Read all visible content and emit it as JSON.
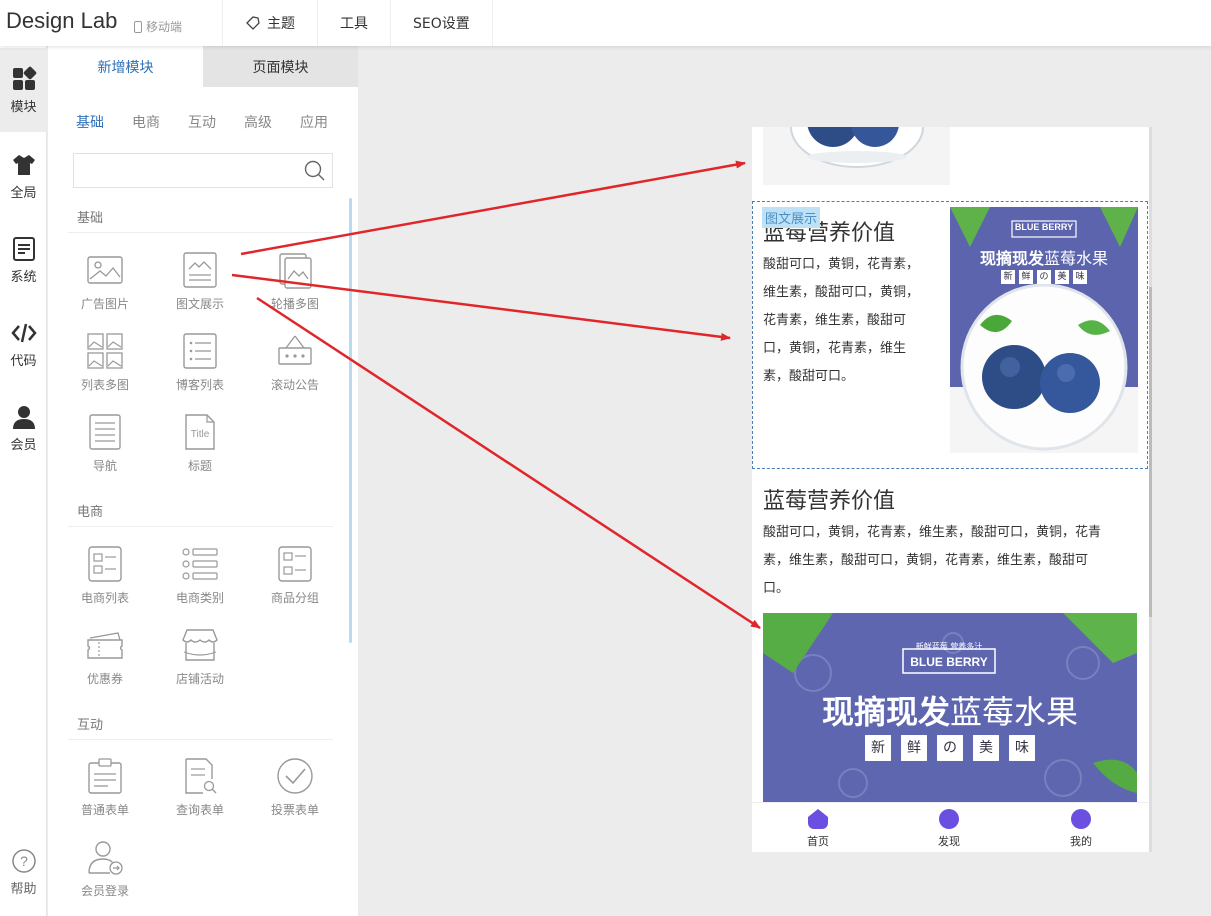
{
  "app": {
    "brand": "Design Lab",
    "mode": "移动端"
  },
  "topnav": [
    {
      "label": "主题",
      "icon": "theme-icon"
    },
    {
      "label": "工具"
    },
    {
      "label": "SEO设置"
    }
  ],
  "rail": [
    {
      "label": "模块",
      "icon": "modules-icon"
    },
    {
      "label": "全局",
      "icon": "shirt-icon"
    },
    {
      "label": "系统",
      "icon": "document-icon"
    },
    {
      "label": "代码",
      "icon": "code-icon"
    },
    {
      "label": "会员",
      "icon": "user-icon"
    },
    {
      "label": "帮助",
      "icon": "help-icon"
    }
  ],
  "panel": {
    "tabs": [
      "新增模块",
      "页面模块"
    ],
    "categories": [
      "基础",
      "电商",
      "互动",
      "高级",
      "应用"
    ],
    "search": {
      "placeholder": "",
      "value": ""
    },
    "sections": [
      {
        "title": "基础",
        "modules": [
          "广告图片",
          "图文展示",
          "轮播多图",
          "列表多图",
          "博客列表",
          "滚动公告",
          "导航",
          "标题"
        ]
      },
      {
        "title": "电商",
        "modules": [
          "电商列表",
          "电商类别",
          "商品分组",
          "优惠券",
          "店铺活动"
        ]
      },
      {
        "title": "互动",
        "modules": [
          "普通表单",
          "查询表单",
          "投票表单",
          "会员登录"
        ]
      }
    ]
  },
  "preview": {
    "selected_tag": "图文展示",
    "card1": {
      "heading": "蓝莓营养价值",
      "lines": [
        "酸甜可口，黄铜，花青素，",
        "维生素，酸甜可口，黄铜，",
        "花青素，维生素，酸甜可",
        "口，黄铜，花青素，维生",
        "素，酸甜可口。"
      ]
    },
    "card2": {
      "heading": "蓝莓营养价值",
      "lines": [
        "酸甜可口，黄铜，花青素，维生素，酸甜可口，黄铜，花青",
        "素，维生素，酸甜可口，黄铜，花青素，维生素，酸甜可",
        "口。"
      ]
    },
    "product_image": {
      "tag": "BLUE BERRY",
      "title_bold": "现摘现发",
      "title_rest": "蓝莓水果",
      "chars": [
        "新",
        "鲜",
        "の",
        "美",
        "味"
      ]
    },
    "banner": {
      "small": "新鲜蓝莓 营养多汁",
      "tag": "BLUE BERRY",
      "title_bold": "现摘现发",
      "title_rest": "蓝莓水果",
      "chars": [
        "新",
        "鲜",
        "の",
        "美",
        "味"
      ]
    },
    "tabbar": [
      "首页",
      "发现",
      "我的"
    ]
  },
  "colors": {
    "accent": "#2f6fb6",
    "arrow": "#e0262b",
    "tab_icon": "#6a4fe0",
    "banner": "#5f66b0"
  }
}
